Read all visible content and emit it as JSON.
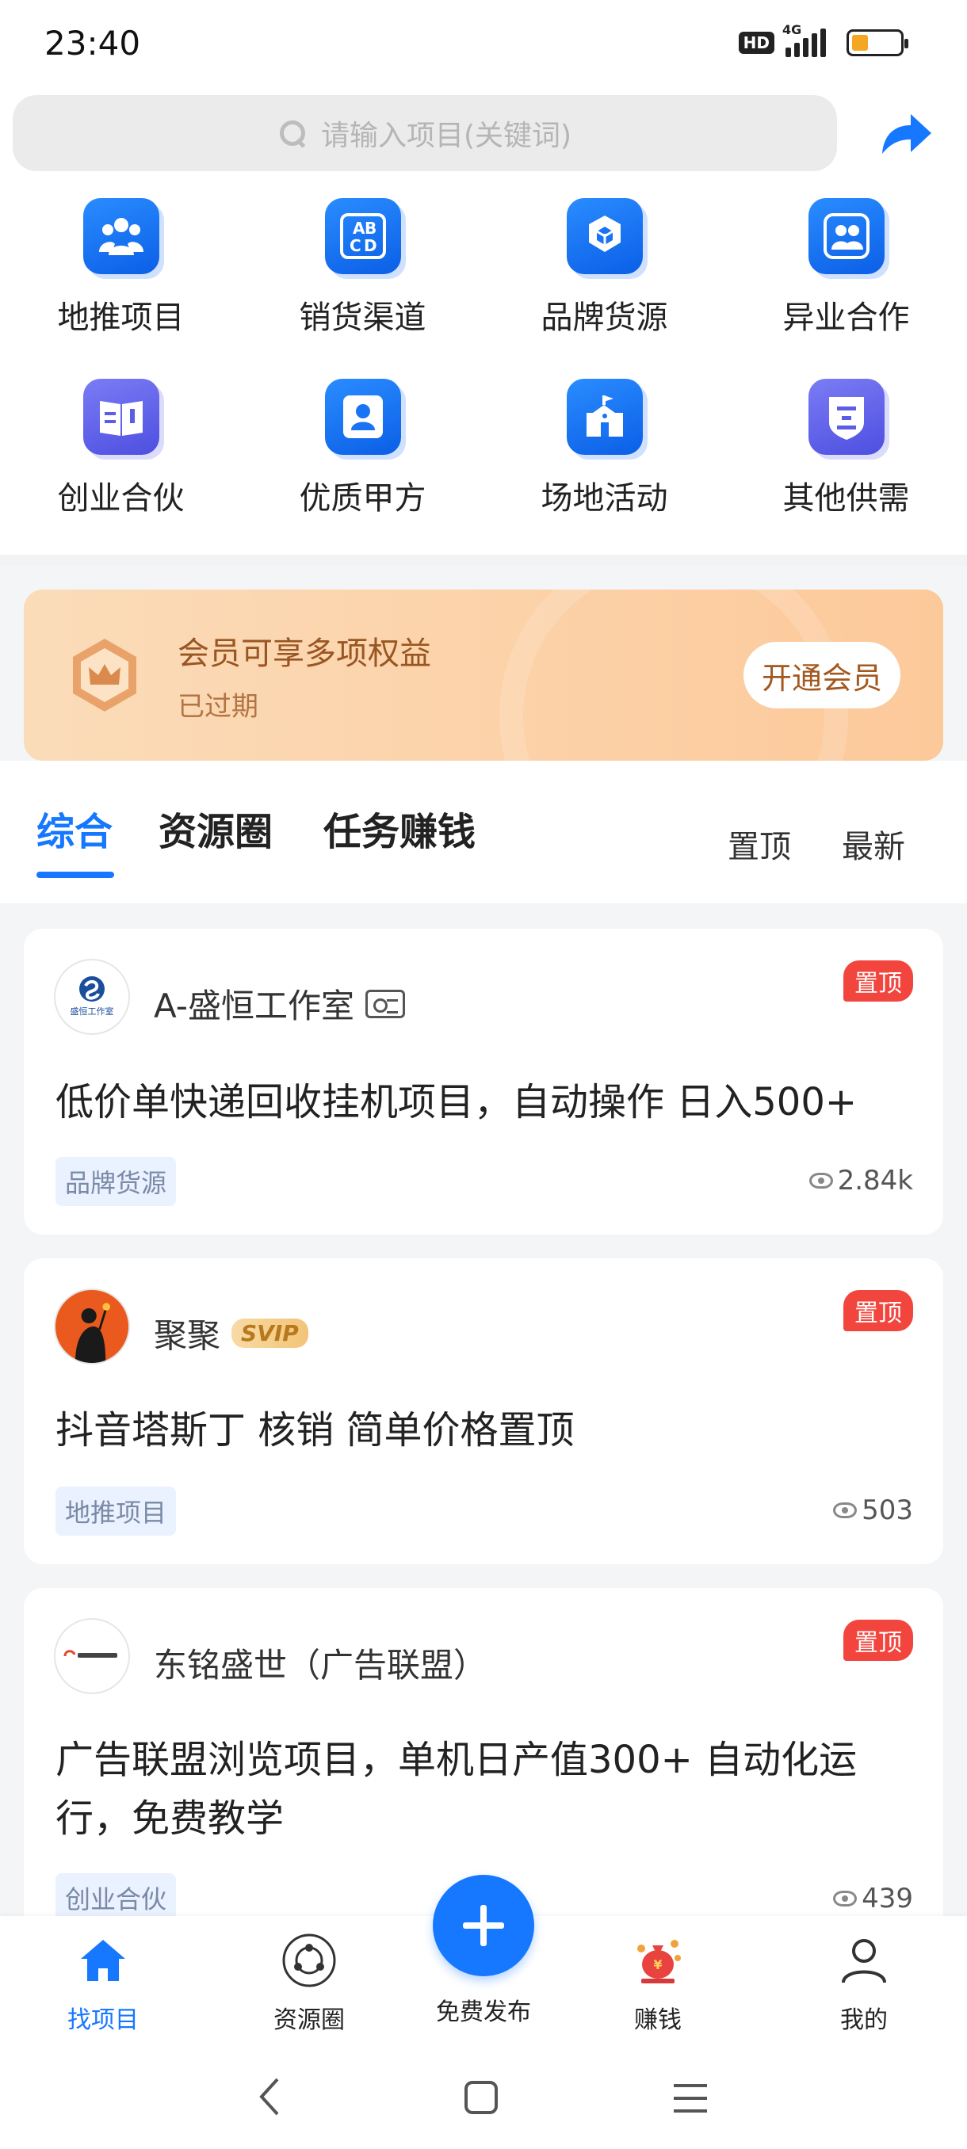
{
  "status_bar": {
    "time": "23:40",
    "hd": "HD",
    "network": "4G"
  },
  "search": {
    "placeholder": "请输入项目(关键词)"
  },
  "categories": [
    {
      "label": "地推项目",
      "icon": "team-icon"
    },
    {
      "label": "销货渠道",
      "icon": "abcd-icon"
    },
    {
      "label": "品牌货源",
      "icon": "cubes-icon"
    },
    {
      "label": "异业合作",
      "icon": "partners-icon"
    },
    {
      "label": "创业合伙",
      "icon": "book-icon"
    },
    {
      "label": "优质甲方",
      "icon": "contact-card-icon"
    },
    {
      "label": "场地活动",
      "icon": "venue-icon"
    },
    {
      "label": "其他供需",
      "icon": "shield-list-icon"
    }
  ],
  "member": {
    "title": "会员可享多项权益",
    "status": "已过期",
    "button": "开通会员"
  },
  "tabs": {
    "items": [
      "综合",
      "资源圈",
      "任务赚钱"
    ],
    "active": 0,
    "sort": [
      "置顶",
      "最新"
    ]
  },
  "posts": [
    {
      "author": "A-盛恒工作室",
      "avatar_text": "盛恒工作室",
      "badge": "id-card-icon",
      "pin": "置顶",
      "title": "低价单快递回收挂机项目，自动操作 日入500+",
      "category": "品牌货源",
      "views": "2.84k"
    },
    {
      "author": "聚聚",
      "badge": "SVIP",
      "pin": "置顶",
      "title": "抖音塔斯丁 核销 简单价格置顶",
      "category": "地推项目",
      "views": "503"
    },
    {
      "author": "东铭盛世（广告联盟）",
      "pin": "置顶",
      "title": "广告联盟浏览项目，单机日产值300+ 自动化运行，免费教学",
      "category": "创业合伙",
      "views": "439"
    }
  ],
  "bottom_nav": {
    "items": [
      {
        "label": "找项目",
        "icon": "home-icon"
      },
      {
        "label": "资源圈",
        "icon": "circle-icon"
      },
      {
        "label": "赚钱",
        "icon": "money-bag-icon"
      },
      {
        "label": "我的",
        "icon": "user-icon"
      }
    ],
    "publish": "免费发布",
    "active": 0
  },
  "colors": {
    "accent": "#1677ff",
    "pin_red": "#f2453d",
    "member_bg": "#fcc99a"
  }
}
